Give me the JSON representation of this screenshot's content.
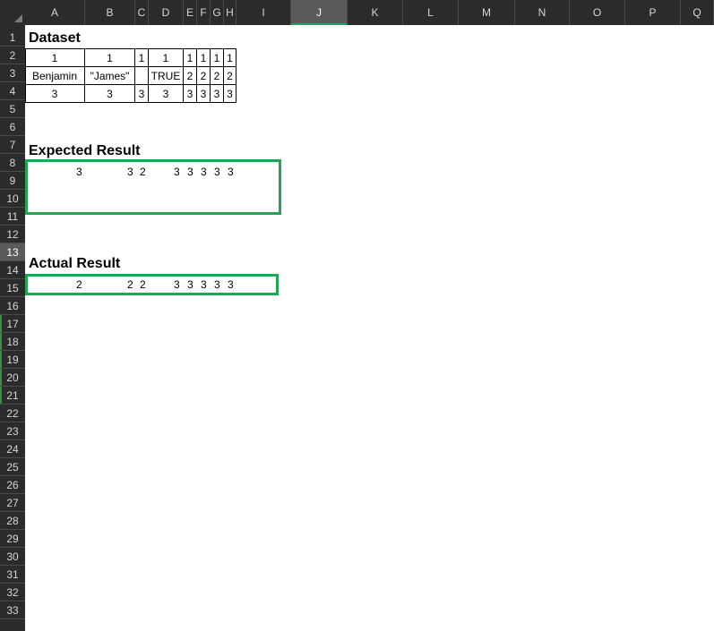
{
  "columns": [
    "A",
    "B",
    "C",
    "D",
    "E",
    "F",
    "G",
    "H",
    "I",
    "J",
    "K",
    "L",
    "M",
    "N",
    "O",
    "P",
    "Q"
  ],
  "selected_column": "J",
  "rows": [
    "1",
    "2",
    "3",
    "4",
    "5",
    "6",
    "7",
    "8",
    "9",
    "10",
    "11",
    "12",
    "13",
    "14",
    "15",
    "16",
    "17",
    "18",
    "19",
    "20",
    "21",
    "22",
    "23",
    "24",
    "25",
    "26",
    "27",
    "28",
    "29",
    "30",
    "31",
    "32",
    "33"
  ],
  "selected_row": "13",
  "headings": {
    "dataset": "Dataset",
    "expected": "Expected Result",
    "actual": "Actual Result"
  },
  "dataset": {
    "row2": [
      "1",
      "1",
      "1",
      "1",
      "1",
      "1",
      "1",
      "1"
    ],
    "row3": [
      "Benjamin",
      "\"James\"",
      "",
      "TRUE",
      "2",
      "2",
      "2",
      "2"
    ],
    "row4": [
      "3",
      "3",
      "3",
      "3",
      "3",
      "3",
      "3",
      "3"
    ]
  },
  "expected": [
    "3",
    "3",
    "2",
    "3",
    "3",
    "3",
    "3",
    "3"
  ],
  "actual": [
    "2",
    "2",
    "2",
    "3",
    "3",
    "3",
    "3",
    "3"
  ],
  "colors": {
    "header_bg": "#2b2b2b",
    "selected_header": "#5a5a5a",
    "accent_green": "#21a651"
  }
}
